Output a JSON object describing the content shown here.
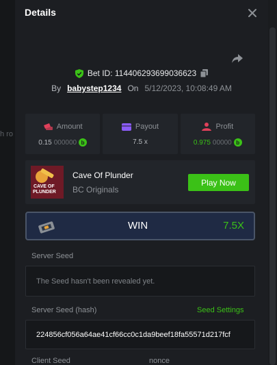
{
  "background_text": "h ro",
  "dialog": {
    "title": "Details",
    "bet_id_label": "Bet ID: 114406293699036623",
    "by_label": "By",
    "username": "babystep1234",
    "on_label": "On",
    "date": "5/12/2023, 10:08:49 AM"
  },
  "stats": {
    "amount": {
      "label": "Amount",
      "value_main": "0.15",
      "value_dim": "000000"
    },
    "payout": {
      "label": "Payout",
      "value": "7.5 x"
    },
    "profit": {
      "label": "Profit",
      "value_main": "0.975",
      "value_dim": "00000"
    }
  },
  "game": {
    "name": "Cave Of Plunder",
    "provider": "BC Originals",
    "thumb_text_1": "CAVE OF",
    "thumb_text_2": "PLUNDER",
    "play_label": "Play Now"
  },
  "result": {
    "label": "WIN",
    "multiplier": "7.5X"
  },
  "server_seed": {
    "label": "Server Seed",
    "value": "The Seed hasn't been revealed yet."
  },
  "server_seed_hash": {
    "label": "Server Seed (hash)",
    "settings_label": "Seed Settings",
    "value": "224856cf056a64ae41cf66cc0c1da9beef18fa55571d217fcf"
  },
  "client_seed": {
    "label": "Client Seed",
    "nonce_label": "nonce"
  },
  "coin_symbol": "b",
  "colors": {
    "accent_green": "#3bc117",
    "amount_icon": "#e0405a",
    "payout_icon": "#8b5cf6",
    "profit_icon": "#e0405a"
  }
}
